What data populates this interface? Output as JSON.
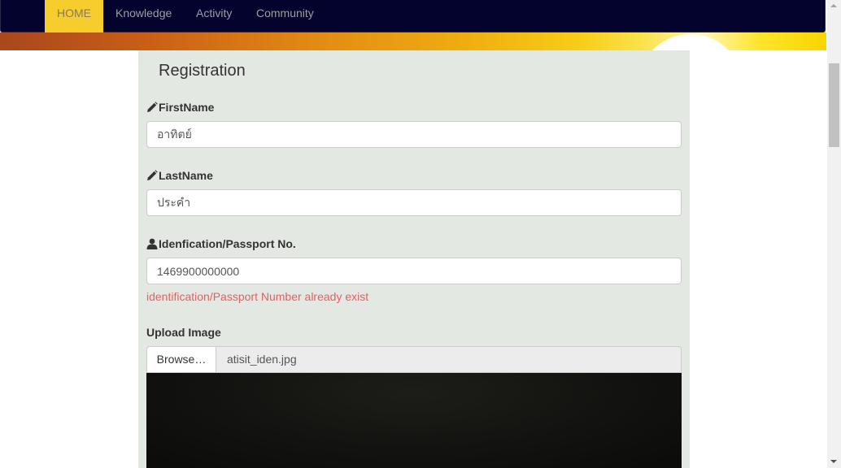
{
  "nav": {
    "home": "HOME",
    "knowledge": "Knowledge",
    "activity": "Activity",
    "community": "Community"
  },
  "form": {
    "title": "Registration",
    "first_name": {
      "label": "FirstName",
      "value": "อาทิตย์"
    },
    "last_name": {
      "label": "LastName",
      "value": "ประคำ"
    },
    "id_number": {
      "label": "Idenfication/Passport No.",
      "value": "1469900000000",
      "error": "identification/Passport Number already exist"
    },
    "upload": {
      "label": "Upload Image",
      "browse_label": "Browse…",
      "file_name": "atisit_iden.jpg"
    }
  },
  "colors": {
    "navbar_bg": "#03032d",
    "nav_active": "#f7cc2d",
    "panel_bg": "#e4e8e3",
    "error": "#e56060"
  },
  "icons": {
    "first_name": "pencil-icon",
    "last_name": "pencil-icon",
    "id_number": "user-icon"
  }
}
